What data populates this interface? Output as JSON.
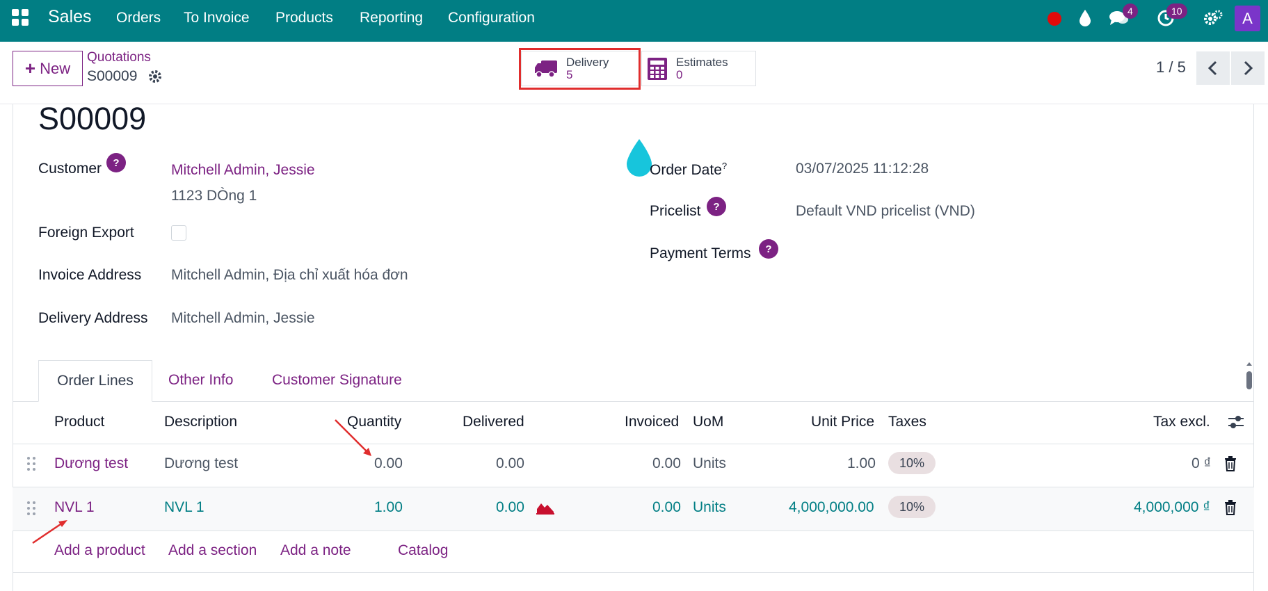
{
  "navbar": {
    "brand": "Sales",
    "menu": [
      "Orders",
      "To Invoice",
      "Products",
      "Reporting",
      "Configuration"
    ],
    "messages_badge": "4",
    "activities_badge": "10",
    "avatar_letter": "A",
    "bg_color": "#017e84"
  },
  "control": {
    "new_label": "New",
    "breadcrumb_parent": "Quotations",
    "breadcrumb_current": "S00009",
    "smart_buttons": [
      {
        "label": "Delivery",
        "value": "5",
        "icon": "truck-icon"
      },
      {
        "label": "Estimates",
        "value": "0",
        "icon": "calculator-icon"
      }
    ],
    "pager": "1 / 5"
  },
  "form": {
    "title": "S00009",
    "customer_label": "Customer",
    "customer_name": "Mitchell Admin, Jessie",
    "customer_address": "1123 DÒng 1",
    "foreign_export_label": "Foreign Export",
    "invoice_address_label": "Invoice Address",
    "invoice_address": "Mitchell Admin, Địa chỉ xuất hóa đơn",
    "delivery_address_label": "Delivery Address",
    "delivery_address": "Mitchell Admin, Jessie",
    "order_date_label": "Order Date",
    "order_date_sup": "?",
    "order_date": "03/07/2025 11:12:28",
    "pricelist_label": "Pricelist",
    "pricelist": "Default VND pricelist (VND)",
    "payment_terms_label": "Payment Terms",
    "help_mark": "?"
  },
  "tabs": [
    "Order Lines",
    "Other Info",
    "Customer Signature"
  ],
  "table": {
    "headers": {
      "product": "Product",
      "description": "Description",
      "quantity": "Quantity",
      "delivered": "Delivered",
      "invoiced": "Invoiced",
      "uom": "UoM",
      "unit_price": "Unit Price",
      "taxes": "Taxes",
      "subtotal": "Tax excl."
    },
    "rows": [
      {
        "product": "Dương test",
        "description": "Dương test",
        "quantity": "0.00",
        "delivered": "0.00",
        "invoiced": "0.00",
        "uom": "Units",
        "unit_price": "1.00",
        "taxes": "10%",
        "subtotal": "0 ₫"
      },
      {
        "product": "NVL 1",
        "description": "NVL 1",
        "quantity": "1.00",
        "delivered": "0.00",
        "invoiced": "0.00",
        "uom": "Units",
        "unit_price": "4,000,000.00",
        "taxes": "10%",
        "subtotal": "4,000,000 ₫"
      }
    ],
    "add_links": [
      "Add a product",
      "Add a section",
      "Add a note",
      "Catalog"
    ]
  }
}
